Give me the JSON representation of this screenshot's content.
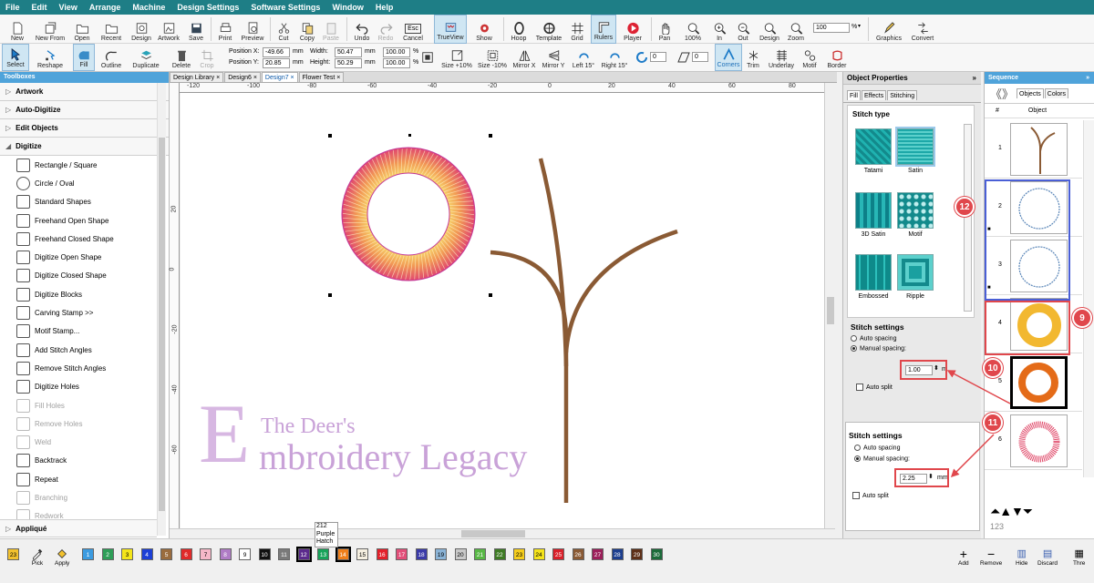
{
  "menu": [
    "File",
    "Edit",
    "View",
    "Arrange",
    "Machine",
    "Design Settings",
    "Software Settings",
    "Window",
    "Help"
  ],
  "toolbar1": {
    "new": "New",
    "new_from": "New From",
    "open": "Open",
    "recent": "Recent",
    "design": "Design",
    "artwork": "Artwork",
    "save": "Save",
    "print": "Print",
    "preview": "Preview",
    "cut": "Cut",
    "copy": "Copy",
    "paste": "Paste",
    "undo": "Undo",
    "redo": "Redo",
    "cancel": "Cancel",
    "esc": "Esc",
    "trueview": "TrueView",
    "show": "Show",
    "hoop": "Hoop",
    "template": "Template",
    "grid": "Grid",
    "rulers": "Rulers",
    "player": "Player",
    "pan": "Pan",
    "zoom100": "100%",
    "zoom_in": "In",
    "zoom_out": "Out",
    "zoom_design": "Design",
    "zoom": "Zoom",
    "zoom_value": "100",
    "zoom_unit": "%",
    "graphics": "Graphics",
    "convert": "Convert"
  },
  "toolbar2": {
    "select": "Select",
    "reshape": "Reshape",
    "fill": "Fill",
    "outline": "Outline",
    "duplicate": "Duplicate",
    "delete": "Delete",
    "crop": "Crop",
    "pos_x_label": "Position X:",
    "pos_x": "-49.66",
    "pos_y_label": "Position Y:",
    "pos_y": "20.85",
    "mm": "mm",
    "width_label": "Width:",
    "width": "50.47",
    "height_label": "Height:",
    "height": "50.29",
    "scale_w": "100.00",
    "scale_h": "100.00",
    "pct": "%",
    "size_up": "Size +10%",
    "size_down": "Size -10%",
    "mirror_x": "Mirror X",
    "mirror_y": "Mirror Y",
    "left15": "Left 15°",
    "right15": "Right 15°",
    "rot_value": "0",
    "slant_value": "0",
    "corners": "Corners",
    "trim": "Trim",
    "underlay": "Underlay",
    "motif": "Motif",
    "border": "Border"
  },
  "toolboxes": {
    "title": "Toolboxes",
    "sections": {
      "artwork": "Artwork",
      "auto_digitize": "Auto-Digitize",
      "edit_objects": "Edit Objects",
      "digitize": "Digitize",
      "applique": "Appliqué"
    },
    "tools": [
      {
        "label": "Rectangle / Square",
        "disabled": false
      },
      {
        "label": "Circle / Oval",
        "disabled": false
      },
      {
        "label": "Standard Shapes",
        "disabled": false
      },
      {
        "label": "Freehand Open Shape",
        "disabled": false
      },
      {
        "label": "Freehand Closed Shape",
        "disabled": false
      },
      {
        "label": "Digitize Open Shape",
        "disabled": false
      },
      {
        "label": "Digitize Closed Shape",
        "disabled": false
      },
      {
        "label": "Digitize Blocks",
        "disabled": false
      },
      {
        "label": "Carving Stamp >>",
        "disabled": false
      },
      {
        "label": "Motif Stamp...",
        "disabled": false
      },
      {
        "label": "Add Stitch Angles",
        "disabled": false
      },
      {
        "label": "Remove Stitch Angles",
        "disabled": false
      },
      {
        "label": "Digitize Holes",
        "disabled": false
      },
      {
        "label": "Fill Holes",
        "disabled": true
      },
      {
        "label": "Remove Holes",
        "disabled": true
      },
      {
        "label": "Weld",
        "disabled": true
      },
      {
        "label": "Backtrack",
        "disabled": false
      },
      {
        "label": "Repeat",
        "disabled": false
      },
      {
        "label": "Branching",
        "disabled": true
      },
      {
        "label": "Redwork",
        "disabled": true
      }
    ]
  },
  "doc_tabs": [
    "Design Library",
    "Design6",
    "Design7",
    "Flower Test"
  ],
  "ruler": {
    "h": [
      "-120",
      "-100",
      "-80",
      "-60",
      "-40",
      "-20",
      "0",
      "20",
      "40",
      "60",
      "80"
    ],
    "v": [
      "20",
      "0",
      "-20",
      "-40",
      "-60"
    ]
  },
  "watermark": {
    "line1": "The Deer's",
    "line2": "mbroidery Legacy",
    "initial": "E"
  },
  "object_properties": {
    "title": "Object Properties",
    "tabs": [
      "Fill",
      "Effects",
      "Stitching"
    ],
    "stitch_type_label": "Stitch type",
    "stitch_types": [
      "Tatami",
      "Satin",
      "3D Satin",
      "Motif",
      "Embossed",
      "Ripple"
    ],
    "settings1": {
      "title": "Stitch settings",
      "auto": "Auto spacing",
      "manual": "Manual spacing:",
      "value": "1.00",
      "unit": "m",
      "split": "Auto split"
    },
    "settings2": {
      "title": "Stitch settings",
      "auto": "Auto spacing",
      "manual": "Manual spacing:",
      "value": "2.25",
      "unit": "mm",
      "split": "Auto split"
    }
  },
  "sequence": {
    "title": "Sequence",
    "tab_objects": "Objects",
    "tab_colors": "Colors",
    "col_num": "#",
    "col_obj": "Object",
    "rows": [
      "1",
      "2",
      "3",
      "4",
      "5",
      "6"
    ],
    "bottom_label": "123"
  },
  "callouts": [
    "12",
    "9",
    "10",
    "11"
  ],
  "palette": {
    "tooltip": [
      "212",
      "Purple",
      "Hatch"
    ],
    "pick": "Pick",
    "apply": "Apply",
    "chips": [
      {
        "n": "23",
        "c": "#f2c12e"
      },
      {
        "n": "1",
        "c": "#3b9be0"
      },
      {
        "n": "2",
        "c": "#2e9e58"
      },
      {
        "n": "3",
        "c": "#f5e61a"
      },
      {
        "n": "4",
        "c": "#1c3fd6"
      },
      {
        "n": "5",
        "c": "#9a6c3e"
      },
      {
        "n": "6",
        "c": "#e02a2a"
      },
      {
        "n": "7",
        "c": "#f5b8c8"
      },
      {
        "n": "8",
        "c": "#b07cc6"
      },
      {
        "n": "9",
        "c": "#ffffff"
      },
      {
        "n": "10",
        "c": "#111111"
      },
      {
        "n": "11",
        "c": "#7a7a7a"
      },
      {
        "n": "12",
        "c": "#5b2a8c"
      },
      {
        "n": "13",
        "c": "#18a35a"
      },
      {
        "n": "14",
        "c": "#f07f1a"
      },
      {
        "n": "15",
        "c": "#f5efe0"
      },
      {
        "n": "16",
        "c": "#e3202a"
      },
      {
        "n": "17",
        "c": "#e24f79"
      },
      {
        "n": "18",
        "c": "#3a3aa8"
      },
      {
        "n": "19",
        "c": "#8ab3d6"
      },
      {
        "n": "20",
        "c": "#c9c9c9"
      },
      {
        "n": "21",
        "c": "#58b845"
      },
      {
        "n": "22",
        "c": "#3e7a24"
      },
      {
        "n": "23",
        "c": "#f5cd1c"
      },
      {
        "n": "24",
        "c": "#f5e31a"
      },
      {
        "n": "25",
        "c": "#d9202a"
      },
      {
        "n": "26",
        "c": "#8a5a34"
      },
      {
        "n": "27",
        "c": "#9c1f5a"
      },
      {
        "n": "28",
        "c": "#1d3f8f"
      },
      {
        "n": "29",
        "c": "#5e3018"
      },
      {
        "n": "30",
        "c": "#1c6b3a"
      }
    ],
    "actions": [
      "Add",
      "Remove",
      "Hide",
      "Discard",
      "Thre"
    ]
  }
}
